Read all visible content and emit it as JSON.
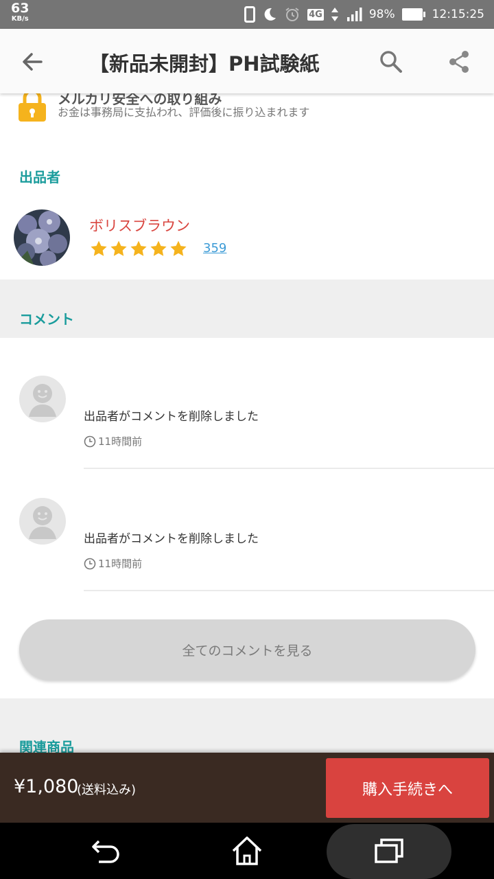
{
  "status_bar": {
    "net_speed": "63",
    "net_unit": "KB/s",
    "network": "4G",
    "battery": "98%",
    "time": "12:15:25"
  },
  "app_bar": {
    "title": "【新品未開封】PH試験紙"
  },
  "safety": {
    "heading": "メルカリ安全への取り組み",
    "description": "お金は事務局に支払われ、評価後に振り込まれます"
  },
  "seller_section": {
    "label": "出品者",
    "name": "ボリスブラウン",
    "rating_stars": 5,
    "review_count": "359"
  },
  "comments_section": {
    "label": "コメント",
    "items": [
      {
        "text": "出品者がコメントを削除しました",
        "time": "11時間前"
      },
      {
        "text": "出品者がコメントを削除しました",
        "time": "11時間前"
      }
    ],
    "see_all_label": "全てのコメントを見る"
  },
  "related_section": {
    "label": "関連商品"
  },
  "purchase_bar": {
    "price": "¥1,080",
    "shipping_note": "(送料込み)",
    "buy_label": "購入手続きへ"
  },
  "colors": {
    "accent_teal": "#1a9c9c",
    "seller_name_red": "#d9453f",
    "buy_button_red": "#d9433f",
    "star_gold": "#f5b31d",
    "bottom_bar_brown": "#3a2a22",
    "link_blue": "#3c9bd6"
  }
}
